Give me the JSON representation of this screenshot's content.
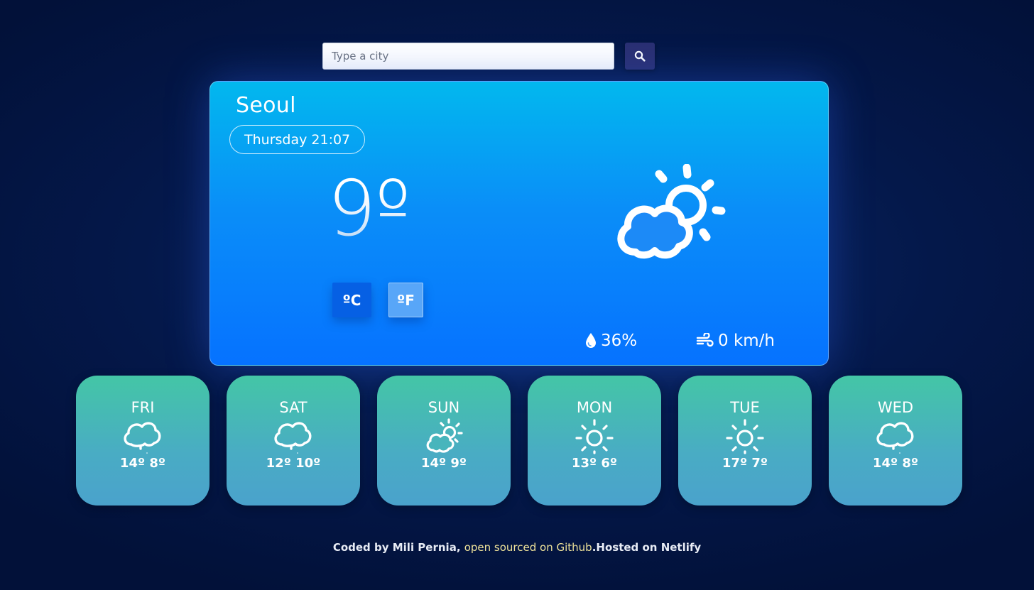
{
  "search": {
    "placeholder": "Type a city",
    "button_icon": "search-icon"
  },
  "current": {
    "city": "Seoul",
    "datetime": "Thursday 21:07",
    "temperature": "9º",
    "units": {
      "celsius": "ºC",
      "fahrenheit": "ºF",
      "active": "celsius"
    },
    "condition_icon": "partly-cloudy-icon",
    "humidity": "36%",
    "humidity_icon": "droplet-icon",
    "wind": "0 km/h",
    "wind_icon": "wind-icon"
  },
  "forecast": [
    {
      "day": "FRI",
      "icon": "rain-cloud-icon",
      "temps": "14º 8º"
    },
    {
      "day": "SAT",
      "icon": "rain-cloud-icon",
      "temps": "12º 10º"
    },
    {
      "day": "SUN",
      "icon": "partly-cloudy-icon",
      "temps": "14º 9º"
    },
    {
      "day": "MON",
      "icon": "sun-icon",
      "temps": "13º 6º"
    },
    {
      "day": "TUE",
      "icon": "sun-icon",
      "temps": "17º 7º"
    },
    {
      "day": "WED",
      "icon": "rain-cloud-icon",
      "temps": "14º 8º"
    }
  ],
  "footer": {
    "prefix": "Coded by Mili Pernia, ",
    "link_text": "open sourced on Github",
    "suffix": ".Hosted on Netlify"
  },
  "colors": {
    "background": "#04184a",
    "card_top": "#02b8ee",
    "card_bottom": "#0672ff",
    "forecast_top": "#44c6a6",
    "forecast_bottom": "#4aa2cc",
    "link": "#f0e39a",
    "search_button": "#2a2f72"
  }
}
